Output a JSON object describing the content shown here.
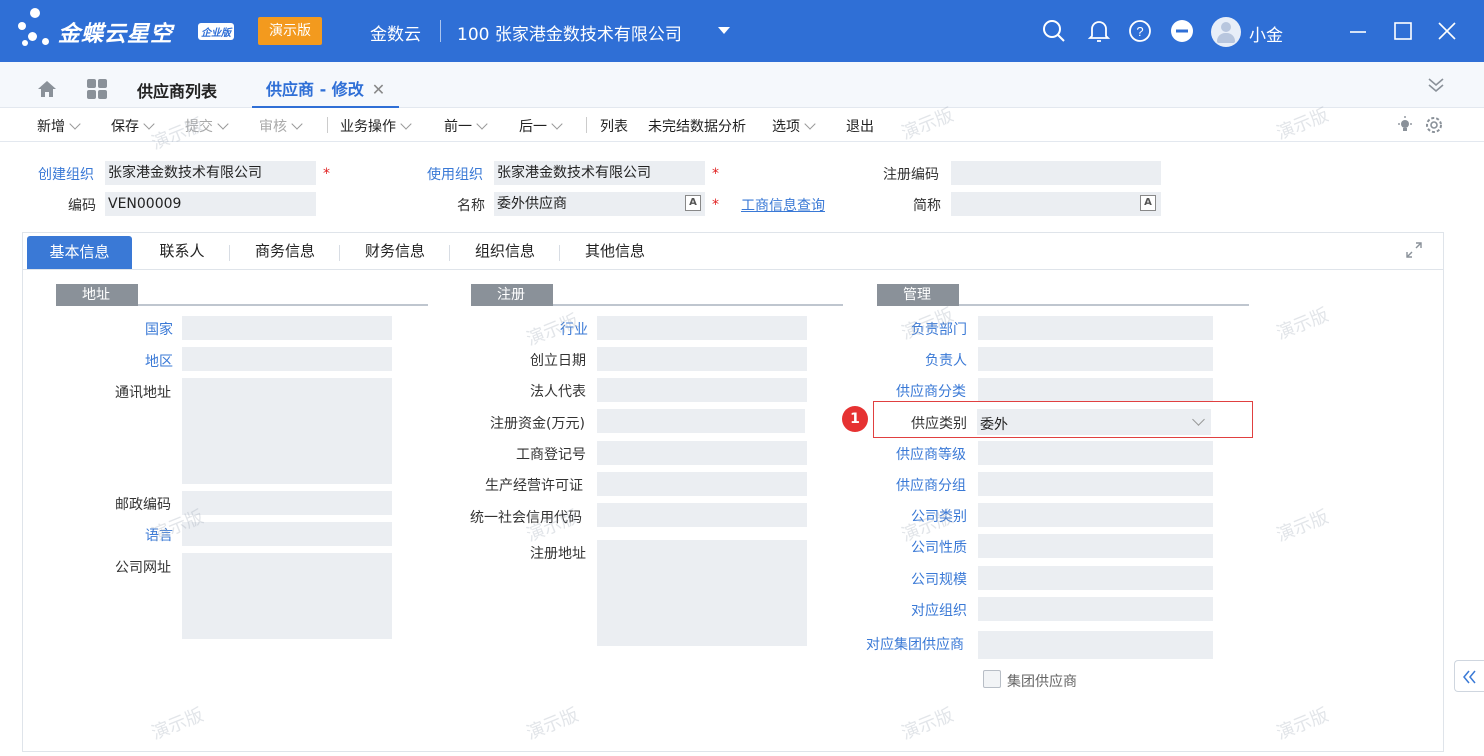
{
  "topbar": {
    "brand": "金蝶云星空",
    "brand_badge": "企业版",
    "demo_label": "演示版",
    "app_name": "金数云",
    "org_name": "100  张家港金数技术有限公司",
    "user_name": "小金"
  },
  "tabs": {
    "list_label": "供应商列表",
    "active_label": "供应商 - 修改",
    "close_glyph": "✕"
  },
  "toolbar": {
    "items": [
      "新增",
      "保存",
      "提交",
      "审核",
      "业务操作",
      "前一",
      "后一",
      "列表",
      "未完结数据分析",
      "选项",
      "退出"
    ]
  },
  "header": {
    "create_org_label": "创建组织",
    "create_org_value": "张家港金数技术有限公司",
    "use_org_label": "使用组织",
    "use_org_value": "张家港金数技术有限公司",
    "reg_code_label": "注册编码",
    "code_label": "编码",
    "code_value": "VEN00009",
    "name_label": "名称",
    "name_value": "委外供应商",
    "biz_query_link": "工商信息查询",
    "short_name_label": "简称",
    "required_mark": "*",
    "lang_icon_glyph": "A"
  },
  "panel": {
    "tabs": [
      "基本信息",
      "联系人",
      "商务信息",
      "财务信息",
      "组织信息",
      "其他信息"
    ],
    "address": {
      "title": "地址",
      "labels": [
        "国家",
        "地区",
        "通讯地址",
        "邮政编码",
        "语言",
        "公司网址"
      ]
    },
    "registration": {
      "title": "注册",
      "labels": [
        "行业",
        "创立日期",
        "法人代表",
        "注册资金(万元)",
        "工商登记号",
        "生产经营许可证",
        "统一社会信用代码",
        "注册地址"
      ]
    },
    "management": {
      "title": "管理",
      "labels": [
        "负责部门",
        "负责人",
        "供应商分类",
        "供应类别",
        "供应商等级",
        "供应商分组",
        "公司类别",
        "公司性质",
        "公司规模",
        "对应组织",
        "对应集团供应商"
      ],
      "supply_type_value": "委外",
      "group_supplier_label": "集团供应商"
    },
    "callout_number": "1"
  },
  "watermark_text": "演示版",
  "colors": {
    "brand_blue": "#2f6fd6",
    "demo_orange": "#f39a1e",
    "link_blue": "#3a79d6",
    "highlight_red": "#e04040"
  }
}
